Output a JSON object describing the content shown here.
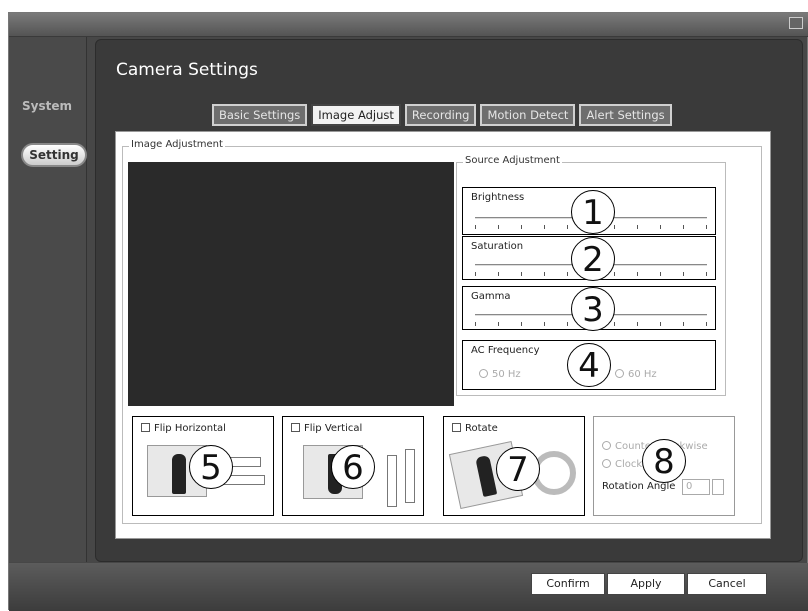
{
  "sidebar": {
    "system_label": "System",
    "setting_label": "Setting"
  },
  "header": {
    "title": "Camera Settings"
  },
  "tabs": [
    {
      "label": "Basic Settings"
    },
    {
      "label": "Image Adjust"
    },
    {
      "label": "Recording"
    },
    {
      "label": "Motion Detect"
    },
    {
      "label": "Alert Settings"
    }
  ],
  "image_adjustment": {
    "legend": "Image Adjustment"
  },
  "source_adjustment": {
    "legend": "Source Adjustment",
    "brightness": {
      "label": "Brightness",
      "marker": "1"
    },
    "saturation": {
      "label": "Saturation",
      "marker": "2"
    },
    "gamma": {
      "label": "Gamma",
      "marker": "3"
    },
    "ac_frequency": {
      "label": "AC Frequency",
      "marker": "4",
      "option_50": "50 Hz",
      "option_60": "60 Hz"
    }
  },
  "flip_horizontal": {
    "label": "Flip Horizontal",
    "marker": "5"
  },
  "flip_vertical": {
    "label": "Flip Vertical",
    "marker": "6"
  },
  "rotate": {
    "label": "Rotate",
    "marker": "7",
    "counter_clockwise": "Counter Clockwise",
    "clockwise": "Clockwise",
    "marker_8": "8",
    "rotation_angle_label": "Rotation Angle",
    "rotation_angle_value": "0"
  },
  "buttons": {
    "confirm": "Confirm",
    "apply": "Apply",
    "cancel": "Cancel"
  }
}
